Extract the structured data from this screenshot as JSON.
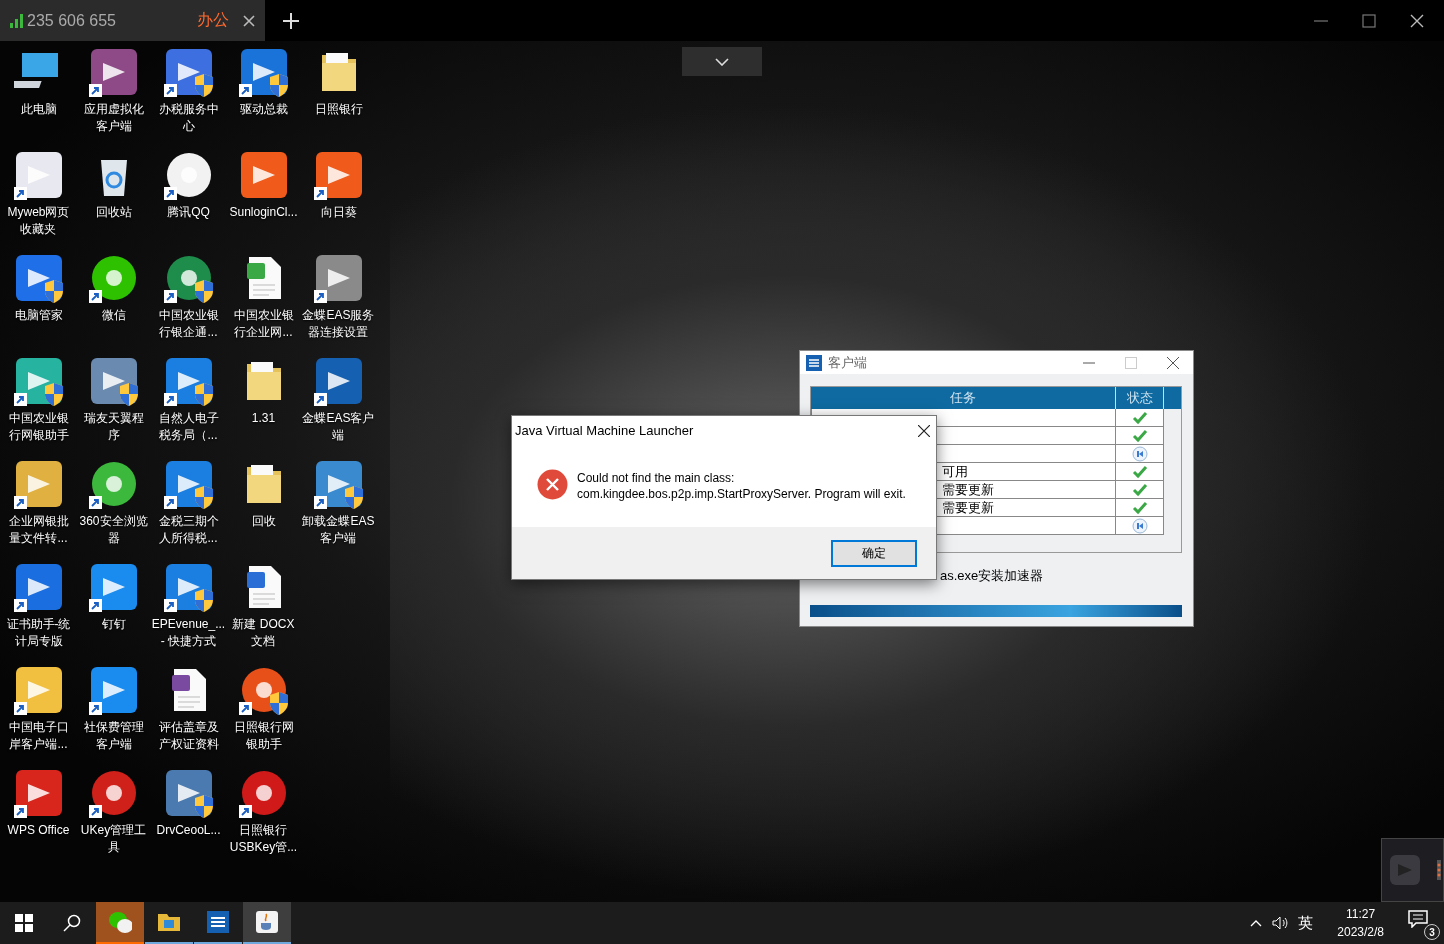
{
  "top_bar": {
    "device_id": "235 606 655",
    "tabs": [
      {
        "label": "办公",
        "selected": true
      }
    ]
  },
  "desktop": {
    "icon_rows": [
      [
        {
          "kind": "computer",
          "label": [
            "此电脑"
          ],
          "shortcut": false,
          "shield": false
        },
        {
          "kind": "tile",
          "color": "#8e4a86",
          "label": [
            "应用虚拟化",
            "客户端"
          ],
          "shortcut": true,
          "shield": false
        },
        {
          "kind": "tile",
          "color": "#3d6fe0",
          "label": [
            "办税服务中",
            "心"
          ],
          "shortcut": true,
          "shield": true
        },
        {
          "kind": "tile",
          "color": "#1a73d9",
          "label": [
            "驱动总裁"
          ],
          "shortcut": true,
          "shield": true
        },
        {
          "kind": "folder",
          "label": [
            "日照银行"
          ],
          "shortcut": false,
          "shield": false
        }
      ],
      [
        {
          "kind": "tile",
          "color": "#e8e8f0",
          "label": [
            "Myweb网页",
            "收藏夹"
          ],
          "shortcut": true,
          "shield": false
        },
        {
          "kind": "recycle",
          "label": [
            "回收站"
          ],
          "shortcut": false,
          "shield": false
        },
        {
          "kind": "round",
          "color": "#f2f2f2",
          "label": [
            "腾讯QQ"
          ],
          "shortcut": true,
          "shield": false
        },
        {
          "kind": "tile",
          "color": "#f05a1a",
          "label": [
            "SunloginCl..."
          ],
          "shortcut": false,
          "shield": false
        },
        {
          "kind": "tile",
          "color": "#f05a1a",
          "label": [
            "向日葵"
          ],
          "shortcut": true,
          "shield": false
        }
      ],
      [
        {
          "kind": "tile",
          "color": "#1f6fe8",
          "label": [
            "电脑管家"
          ],
          "shortcut": false,
          "shield": true
        },
        {
          "kind": "round",
          "color": "#2dc100",
          "label": [
            "微信"
          ],
          "shortcut": true,
          "shield": false
        },
        {
          "kind": "round",
          "color": "#1e8c4a",
          "label": [
            "中国农业银",
            "行银企通..."
          ],
          "shortcut": true,
          "shield": true
        },
        {
          "kind": "document",
          "color": "#3aa845",
          "label": [
            "中国农业银",
            "行企业网..."
          ],
          "shortcut": false,
          "shield": false
        },
        {
          "kind": "tile",
          "color": "#8a8a8a",
          "label": [
            "金蝶EAS服务",
            "器连接设置"
          ],
          "shortcut": true,
          "shield": false
        }
      ],
      [
        {
          "kind": "tile",
          "color": "#26b3a0",
          "label": [
            "中国农业银",
            "行网银助手"
          ],
          "shortcut": true,
          "shield": true
        },
        {
          "kind": "tile",
          "color": "#6a8ab0",
          "label": [
            "瑞友天翼程",
            "序"
          ],
          "shortcut": false,
          "shield": true
        },
        {
          "kind": "tile",
          "color": "#1a7fe0",
          "label": [
            "自然人电子",
            "税务局（..."
          ],
          "shortcut": true,
          "shield": true
        },
        {
          "kind": "folder",
          "label": [
            "1.31"
          ],
          "shortcut": false,
          "shield": false
        },
        {
          "kind": "tile",
          "color": "#1560b0",
          "label": [
            "金蝶EAS客户",
            "端"
          ],
          "shortcut": true,
          "shield": false
        }
      ],
      [
        {
          "kind": "tile",
          "color": "#e0b040",
          "label": [
            "企业网银批",
            "量文件转..."
          ],
          "shortcut": true,
          "shield": false
        },
        {
          "kind": "round",
          "color": "#3cb83c",
          "label": [
            "360安全浏览",
            "器"
          ],
          "shortcut": true,
          "shield": false
        },
        {
          "kind": "tile",
          "color": "#1a7fe0",
          "label": [
            "金税三期个",
            "人所得税..."
          ],
          "shortcut": true,
          "shield": true
        },
        {
          "kind": "folder",
          "label": [
            "回收"
          ],
          "shortcut": false,
          "shield": false
        },
        {
          "kind": "tile",
          "color": "#3a8ad0",
          "label": [
            "卸载金蝶EAS",
            "客户端"
          ],
          "shortcut": true,
          "shield": true
        }
      ],
      [
        {
          "kind": "tile",
          "color": "#1a6ee0",
          "label": [
            "证书助手-统",
            "计局专版"
          ],
          "shortcut": true,
          "shield": false
        },
        {
          "kind": "tile",
          "color": "#1a8cf0",
          "label": [
            "钉钉"
          ],
          "shortcut": true,
          "shield": false
        },
        {
          "kind": "tile",
          "color": "#1a7fe0",
          "label": [
            "EPEvenue_...",
            "- 快捷方式"
          ],
          "shortcut": true,
          "shield": true
        },
        {
          "kind": "document",
          "color": "#2b6fd6",
          "label": [
            "新建 DOCX",
            "文档"
          ],
          "shortcut": false,
          "shield": false
        }
      ],
      [
        {
          "kind": "tile",
          "color": "#f2c040",
          "label": [
            "中国电子口",
            "岸客户端..."
          ],
          "shortcut": true,
          "shield": false
        },
        {
          "kind": "tile",
          "color": "#1a8cf0",
          "label": [
            "社保费管理",
            "客户端"
          ],
          "shortcut": true,
          "shield": false
        },
        {
          "kind": "document",
          "color": "#7a4aa0",
          "label": [
            "评估盖章及",
            "产权证资料"
          ],
          "shortcut": false,
          "shield": false
        },
        {
          "kind": "round",
          "color": "#e8501a",
          "label": [
            "日照银行网",
            "银助手"
          ],
          "shortcut": true,
          "shield": true
        }
      ],
      [
        {
          "kind": "tile",
          "color": "#d8261c",
          "label": [
            "WPS Office"
          ],
          "shortcut": true,
          "shield": false
        },
        {
          "kind": "round",
          "color": "#d0201a",
          "label": [
            "UKey管理工",
            "具"
          ],
          "shortcut": true,
          "shield": false
        },
        {
          "kind": "tile",
          "color": "#4a7ab0",
          "label": [
            "DrvCeooL..."
          ],
          "shortcut": false,
          "shield": true
        },
        {
          "kind": "round",
          "color": "#d01a1a",
          "label": [
            "日照银行",
            "USBKey管..."
          ],
          "shortcut": true,
          "shield": false
        }
      ]
    ]
  },
  "eas_window": {
    "title": "客户端",
    "columns": [
      "任务",
      "状态"
    ],
    "rows": [
      {
        "done": true
      },
      {
        "done": true
      },
      {
        "done": false
      },
      {
        "task": "可用",
        "done": true
      },
      {
        "task": "需要更新",
        "done": true
      },
      {
        "task": "需要更新",
        "done": true
      },
      {
        "done": false
      }
    ],
    "message": "as.exe安装加速器",
    "progress": {
      "level": 1
    }
  },
  "dialog": {
    "title": "Java Virtual Machine Launcher",
    "message": [
      "Could not find the main class:",
      "com.kingdee.bos.p2p.imp.StartProxyServer.  Program will exit."
    ],
    "button": "确定"
  },
  "taskbar": {
    "apps": [
      {
        "kind": "wechat",
        "flashing": true,
        "selected": false
      },
      {
        "kind": "explorer",
        "flashing": false,
        "selected": false
      },
      {
        "kind": "eas",
        "flashing": false,
        "selected": false
      },
      {
        "kind": "java",
        "flashing": false,
        "selected": true
      }
    ],
    "ime": "英",
    "time": "11:27",
    "date": "2023/2/8",
    "notifications": "3"
  }
}
